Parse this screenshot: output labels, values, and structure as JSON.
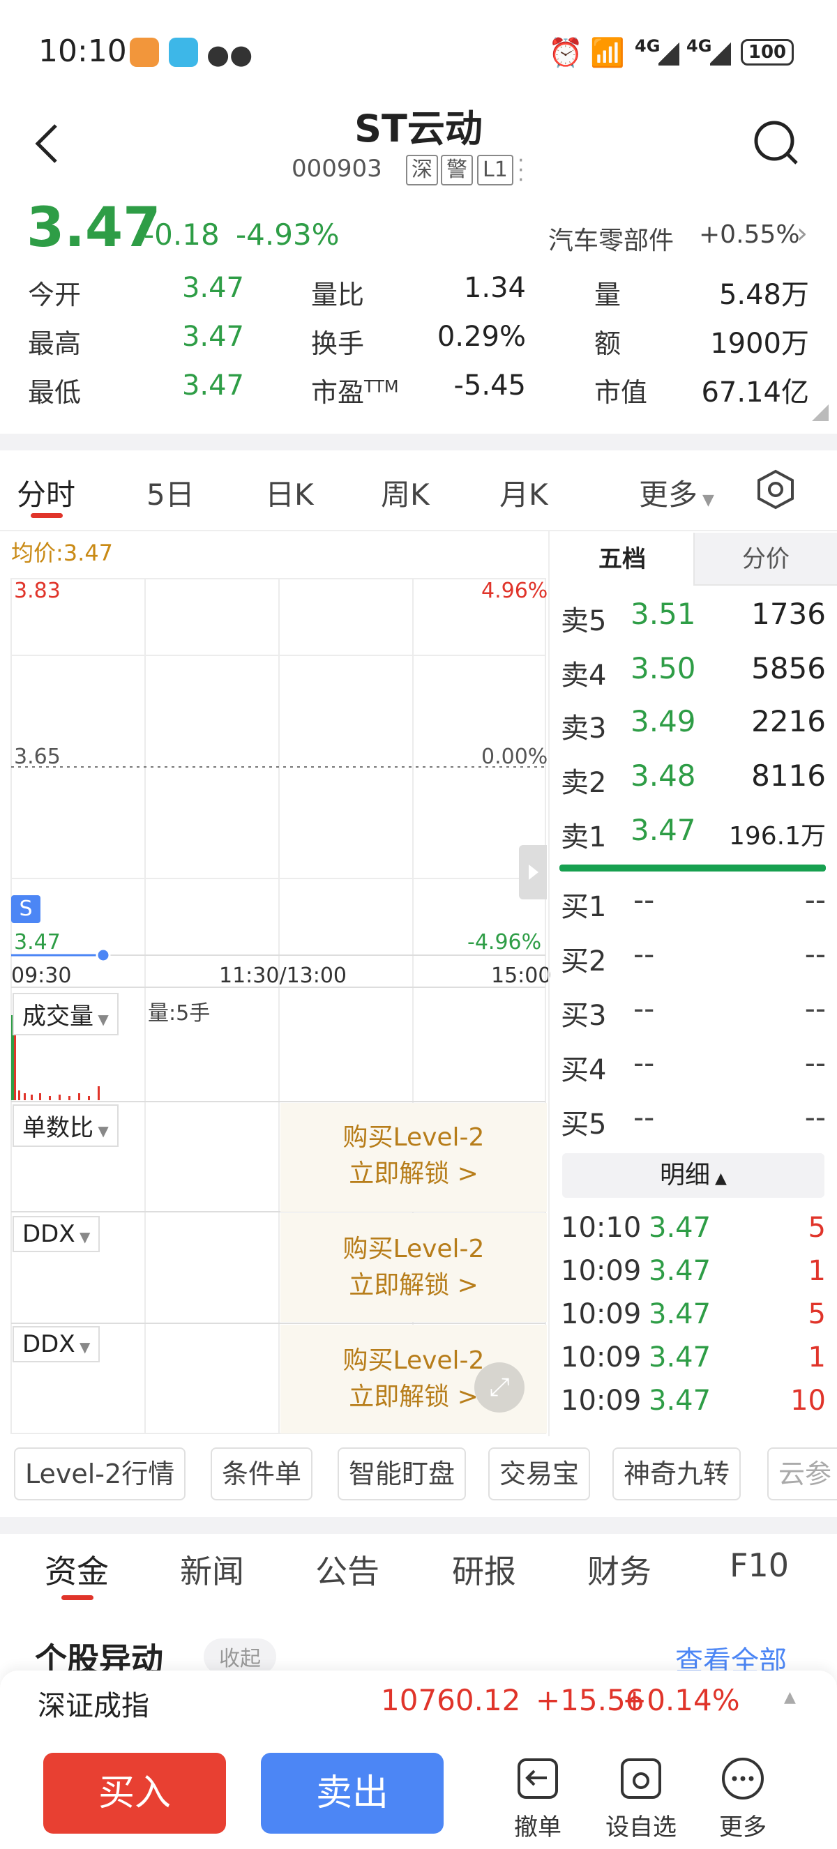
{
  "status_bar": {
    "time": "10:10",
    "network_1": "4G",
    "network_2": "4G",
    "battery": "100"
  },
  "header": {
    "title": "ST云动",
    "code": "000903",
    "tags": [
      "深",
      "警",
      "L1"
    ]
  },
  "quote": {
    "price": "3.47",
    "change": "-0.18",
    "change_pct": "-4.93%",
    "sector": "汽车零部件",
    "sector_change": "+0.55%",
    "rows": [
      [
        {
          "label": "今开",
          "value": "3.47"
        },
        {
          "label": "量比",
          "value": "1.34"
        },
        {
          "label": "量",
          "value": "5.48万"
        }
      ],
      [
        {
          "label": "最高",
          "value": "3.47"
        },
        {
          "label": "换手",
          "value": "0.29%"
        },
        {
          "label": "额",
          "value": "1900万"
        }
      ],
      [
        {
          "label": "最低",
          "value": "3.47"
        },
        {
          "label": "市盈",
          "label_sup": "TTM",
          "value": "-5.45"
        },
        {
          "label": "市值",
          "value": "67.14亿"
        }
      ]
    ]
  },
  "chart_tabs": [
    "分时",
    "5日",
    "日K",
    "周K",
    "月K",
    "更多"
  ],
  "chart": {
    "avg_price": "均价:3.47",
    "y_top": "3.83",
    "y_top_pct": "4.96%",
    "y_mid": "3.65",
    "y_mid_pct": "0.00%",
    "y_bot": "3.47",
    "y_bot_pct": "-4.96%",
    "x_labels": [
      "09:30",
      "11:30/13:00",
      "15:00"
    ],
    "s_marker": "S",
    "volume_label": "成交量",
    "volume_value": "量:5手",
    "indicator_2": "单数比",
    "indicator_3": "DDX",
    "indicator_4": "DDX",
    "level2_line1": "购买Level-2",
    "level2_line2": "立即解锁 >"
  },
  "order_book": {
    "tabs": [
      "五档",
      "分价"
    ],
    "sell": [
      {
        "label": "卖5",
        "price": "3.51",
        "vol": "1736"
      },
      {
        "label": "卖4",
        "price": "3.50",
        "vol": "5856"
      },
      {
        "label": "卖3",
        "price": "3.49",
        "vol": "2216"
      },
      {
        "label": "卖2",
        "price": "3.48",
        "vol": "8116"
      },
      {
        "label": "卖1",
        "price": "3.47",
        "vol": "196.1万"
      }
    ],
    "buy": [
      {
        "label": "买1",
        "price": "--",
        "vol": "--"
      },
      {
        "label": "买2",
        "price": "--",
        "vol": "--"
      },
      {
        "label": "买3",
        "price": "--",
        "vol": "--"
      },
      {
        "label": "买4",
        "price": "--",
        "vol": "--"
      },
      {
        "label": "买5",
        "price": "--",
        "vol": "--"
      }
    ],
    "detail_label": "明细",
    "details": [
      {
        "time": "10:10",
        "price": "3.47",
        "vol": "5"
      },
      {
        "time": "10:09",
        "price": "3.47",
        "vol": "1"
      },
      {
        "time": "10:09",
        "price": "3.47",
        "vol": "5"
      },
      {
        "time": "10:09",
        "price": "3.47",
        "vol": "1"
      },
      {
        "time": "10:09",
        "price": "3.47",
        "vol": "10"
      }
    ]
  },
  "chips": [
    "Level-2行情",
    "条件单",
    "智能盯盘",
    "交易宝",
    "神奇九转",
    "云参"
  ],
  "bottom_tabs": [
    "资金",
    "新闻",
    "公告",
    "研报",
    "财务",
    "F10"
  ],
  "section": {
    "title": "个股异动",
    "collapse": "收起",
    "view_all": "查看全部"
  },
  "index_bar": {
    "name": "深证成指",
    "value": "10760.12",
    "change": "+15.56",
    "pct": "+0.14%"
  },
  "actions": {
    "buy": "买入",
    "sell": "卖出",
    "cancel": "撤单",
    "watch": "设自选",
    "more": "更多"
  },
  "colors": {
    "up": "#e0342a",
    "down": "#2e9d46",
    "buy_btn": "#e84032",
    "sell_btn": "#4c86f5",
    "gold": "#c98a15"
  }
}
